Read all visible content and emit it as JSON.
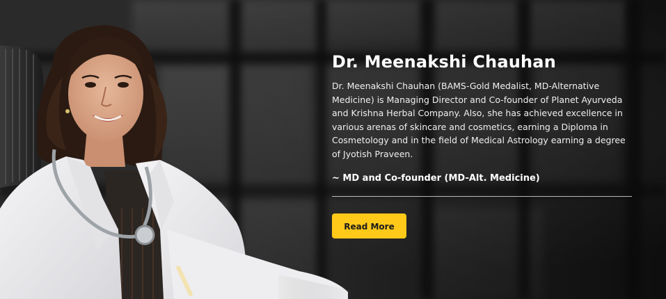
{
  "profile": {
    "name": "Dr. Meenakshi Chauhan",
    "bio": "Dr. Meenakshi Chauhan (BAMS-Gold Medalist, MD-Alternative Medicine) is Managing Director and Co-founder of Planet Ayurveda and Krishna Herbal Company. Also, she has achieved excellence in various arenas of skincare and cosmetics, earning a Diploma in Cosmetology and in the field of Medical Astrology earning a degree of Jyotish Praveen.",
    "role": "~ MD and Co-founder (MD-Alt. Medicine)"
  },
  "cta": {
    "label": "Read More",
    "color": "#ffc91a"
  }
}
